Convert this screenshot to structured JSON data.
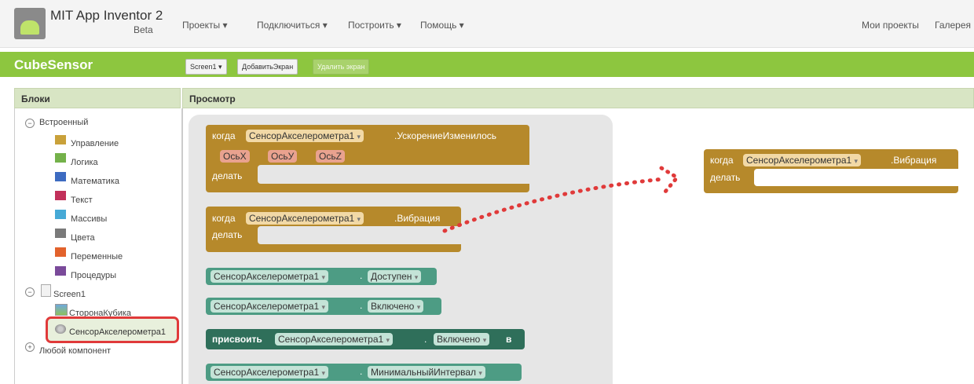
{
  "header": {
    "app_name": "MIT App Inventor 2",
    "beta": "Beta",
    "menus": [
      "Проекты ▾",
      "Подключиться ▾",
      "Построить ▾",
      "Помощь ▾"
    ],
    "right_links": [
      "Мои проекты",
      "Галерея"
    ]
  },
  "project": {
    "name": "CubeSensor",
    "screen_select": "Screen1 ▾",
    "add_screen": "ДобавитьЭкран",
    "remove_screen": "Удалить экран"
  },
  "panels": {
    "blocks_title": "Блоки",
    "viewer_title": "Просмотр"
  },
  "tree": {
    "builtin": "Встроенный",
    "builtin_items": [
      {
        "label": "Управление",
        "color": "#c9a13a"
      },
      {
        "label": "Логика",
        "color": "#74b14a"
      },
      {
        "label": "Математика",
        "color": "#3d6bc1"
      },
      {
        "label": "Текст",
        "color": "#c2305a"
      },
      {
        "label": "Массивы",
        "color": "#46a9d6"
      },
      {
        "label": "Цвета",
        "color": "#7a7a7a"
      },
      {
        "label": "Переменные",
        "color": "#e2622c"
      },
      {
        "label": "Процедуры",
        "color": "#7a4a9a"
      }
    ],
    "screen": "Screen1",
    "components": [
      "СторонаКубика",
      "СенсорАкселерометра1"
    ],
    "any_component": "Любой компонент"
  },
  "blocks": {
    "when": "когда",
    "do": "делать",
    "component": "СенсорАкселерометра1",
    "event_accel": ".УскорениеИзменилось",
    "params": [
      "ОсьX",
      "ОсьУ",
      "ОсьZ"
    ],
    "event_shake": ".Вибрация",
    "prop_available": "Доступен",
    "prop_enabled": "Включено",
    "set": "присвоить",
    "to": "в",
    "prop_min_interval": "МинимальныйИнтервал",
    "dot": "."
  },
  "colors": {
    "accent_green": "#8dc63f",
    "event_block": "#b6892b",
    "component_block": "#4d9c84",
    "highlight_red": "#e03a3a"
  }
}
